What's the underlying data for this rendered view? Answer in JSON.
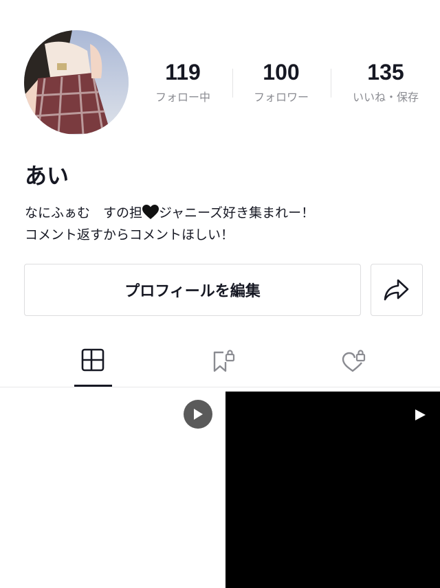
{
  "profile": {
    "avatar_icon": "user-avatar-photo",
    "username": "あい",
    "bio_line1_a": "なにふぁむ　すの担",
    "bio_emoji_icon": "black-heart-icon",
    "bio_line1_b": "ジャニーズ好き集まれー！",
    "bio_line2": "コメント返すからコメントほしい！"
  },
  "stats": {
    "following": {
      "value": "119",
      "label": "フォロー中"
    },
    "followers": {
      "value": "100",
      "label": "フォロワー"
    },
    "likes": {
      "value": "135",
      "label": "いいね・保存"
    }
  },
  "actions": {
    "edit_label": "プロフィールを編集",
    "share_icon": "share-arrow-icon"
  },
  "tabs": [
    {
      "name": "videos",
      "icon": "grid-icon",
      "active": true
    },
    {
      "name": "saved",
      "icon": "locked-bookmark-icon",
      "active": false
    },
    {
      "name": "liked",
      "icon": "locked-heart-icon",
      "active": false
    }
  ],
  "videos": [
    {
      "background": "#ffffff",
      "icon": "play-circle-icon"
    },
    {
      "background": "#000000",
      "icon": "play-icon"
    }
  ],
  "colors": {
    "text_primary": "#161823",
    "text_secondary": "#8a8b91",
    "border": "#dcdcde"
  }
}
